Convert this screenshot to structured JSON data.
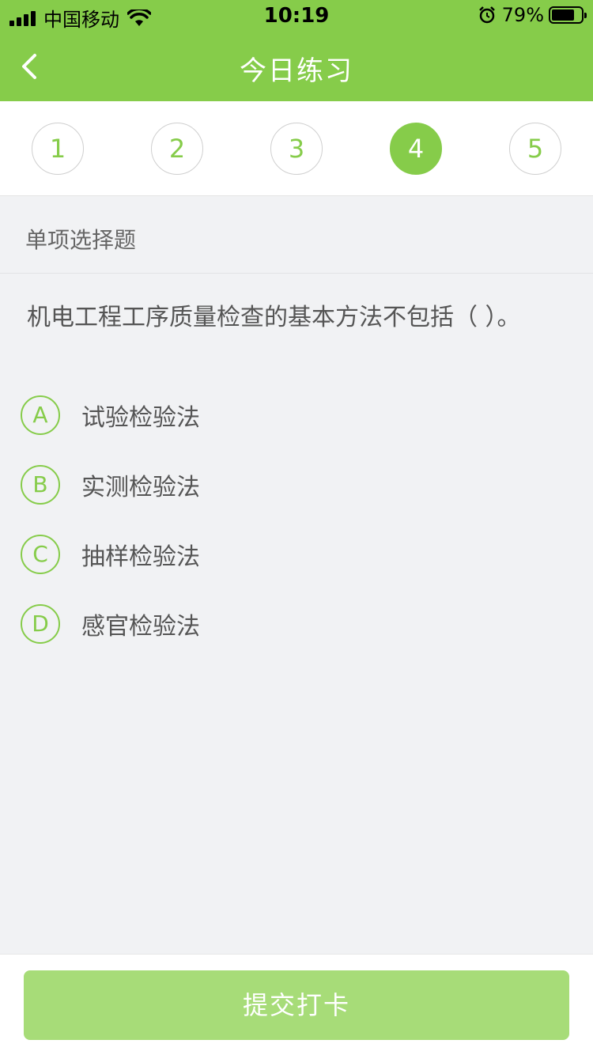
{
  "status_bar": {
    "carrier": "中国移动",
    "time": "10:19",
    "battery_percent": "79%",
    "battery_level": 0.79,
    "icons": [
      "signal-icon",
      "wifi-icon",
      "alarm-icon",
      "battery-icon"
    ]
  },
  "nav": {
    "title": "今日练习",
    "back_icon": "chevron-left-icon"
  },
  "steps": {
    "items": [
      "1",
      "2",
      "3",
      "4",
      "5"
    ],
    "active": "4"
  },
  "question": {
    "type_label": "单项选择题",
    "text": "机电工程工序质量检查的基本方法不包括（   ）。",
    "options": [
      {
        "letter": "A",
        "text": "试验检验法"
      },
      {
        "letter": "B",
        "text": "实测检验法"
      },
      {
        "letter": "C",
        "text": "抽样检验法"
      },
      {
        "letter": "D",
        "text": "感官检验法"
      }
    ]
  },
  "footer": {
    "submit_label": "提交打卡"
  },
  "colors": {
    "brand_green": "#86cc4a",
    "submit_disabled": "#a7dc78",
    "background": "#f1f2f4"
  }
}
